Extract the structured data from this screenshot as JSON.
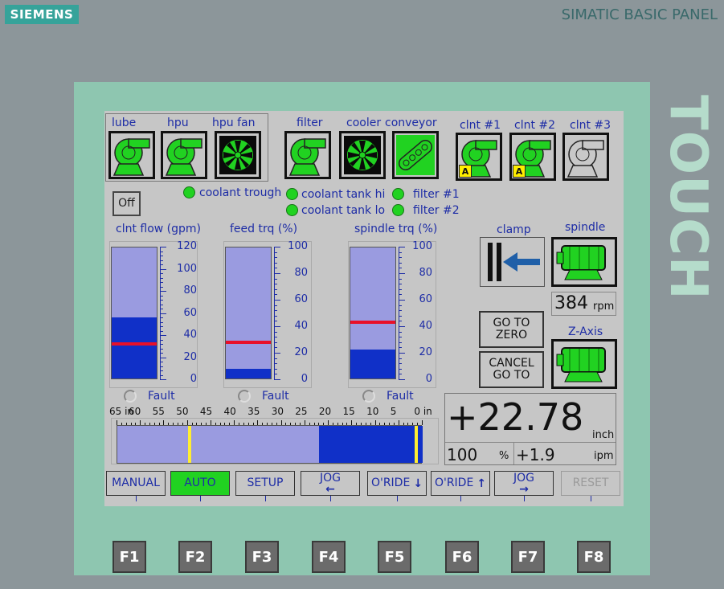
{
  "brand": "SIEMENS",
  "model": "SIMATIC BASIC PANEL",
  "bezel_text": "TOUCH",
  "equipment": [
    {
      "label": "lube",
      "type": "pump",
      "state": "on"
    },
    {
      "label": "hpu",
      "type": "pump",
      "state": "on"
    },
    {
      "label": "hpu fan",
      "type": "fan",
      "state": "on"
    },
    {
      "label": "filter",
      "type": "pump",
      "state": "on"
    },
    {
      "label": "cooler",
      "type": "fan",
      "state": "on"
    },
    {
      "label": "conveyor",
      "type": "conveyor",
      "state": "on"
    },
    {
      "label": "clnt #1",
      "type": "pump",
      "state": "on",
      "badge": "A"
    },
    {
      "label": "clnt #2",
      "type": "pump",
      "state": "on",
      "badge": "A"
    },
    {
      "label": "clnt #3",
      "type": "pump",
      "state": "off"
    }
  ],
  "off_button": "Off",
  "indicators": [
    "coolant trough",
    "coolant tank hi",
    "coolant tank lo",
    "filter #1",
    "filter #2"
  ],
  "gauges": [
    {
      "title": "clnt flow (gpm)",
      "ticks": [
        "120",
        "100",
        "80",
        "60",
        "40",
        "20",
        "0"
      ],
      "max": 120,
      "value": 55,
      "setpoint": 30,
      "fault": "Fault"
    },
    {
      "title": "feed trq (%)",
      "ticks": [
        "100",
        "80",
        "60",
        "40",
        "20",
        "0"
      ],
      "max": 100,
      "value": 7,
      "setpoint": 26,
      "fault": "Fault"
    },
    {
      "title": "spindle trq (%)",
      "ticks": [
        "100",
        "80",
        "60",
        "40",
        "20",
        "0"
      ],
      "max": 100,
      "value": 22,
      "setpoint": 41,
      "fault": "Fault"
    }
  ],
  "clamp_label": "clamp",
  "spindle_label": "spindle",
  "spindle_rpm": "384",
  "rpm_unit": "rpm",
  "zaxis_label": "Z-Axis",
  "go_to_zero": "GO TO ZERO",
  "cancel_go_to": "CANCEL GO TO",
  "position_value": "+22.78",
  "position_unit": "inch",
  "override_value": "100",
  "override_unit": "%",
  "feed_value": "+1.9",
  "feed_unit": "ipm",
  "travel": {
    "labels": [
      "65 in",
      "60",
      "55",
      "50",
      "45",
      "40",
      "35",
      "30",
      "25",
      "20",
      "15",
      "10",
      "5",
      "0 in"
    ],
    "fill_from": 22,
    "marker_a": 50,
    "marker_b": 1
  },
  "buttons": [
    {
      "label": "MANUAL",
      "state": "normal"
    },
    {
      "label": "AUTO",
      "state": "active"
    },
    {
      "label": "SETUP",
      "state": "normal"
    },
    {
      "label": "JOG",
      "state": "normal",
      "arrow": "←"
    },
    {
      "label": "O'RIDE",
      "state": "normal",
      "arrow": "↓"
    },
    {
      "label": "O'RIDE",
      "state": "normal",
      "arrow": "↑"
    },
    {
      "label": "JOG",
      "state": "normal",
      "arrow": "→"
    },
    {
      "label": "RESET",
      "state": "disabled"
    }
  ],
  "fkeys": [
    "F1",
    "F2",
    "F3",
    "F4",
    "F5",
    "F6",
    "F7",
    "F8"
  ],
  "colors": {
    "pump_green": "#21d221",
    "bar_fill": "#1030c8",
    "bar_bg": "#9a9be0",
    "setpoint": "#e8102a",
    "marker": "#ffee33",
    "label_blue": "#1d2ca6"
  }
}
